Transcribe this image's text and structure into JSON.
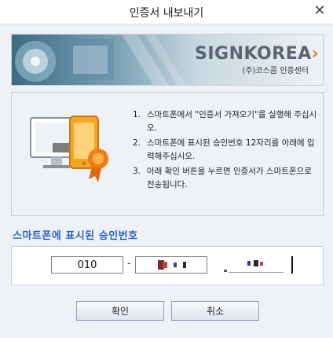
{
  "window": {
    "title": "인증서 내보내기",
    "close_glyph": "✕"
  },
  "banner": {
    "logo_text": "SIGNKOREA",
    "logo_arrow": "›",
    "logo_subtitle": "(주)코스콤 인증센터",
    "accent_color": "#f07b18"
  },
  "instructions": {
    "steps": [
      {
        "num": "1.",
        "text": "스마트폰에서 \"인증서 가져오기\"를 실행해 주십시오."
      },
      {
        "num": "2.",
        "text": "스마트폰에 표시된 승인번호 12자리를 아래에 입력해주십시오."
      },
      {
        "num": "3.",
        "text": "아래 확인 버튼을 누르면 인증서가 스마트폰으로 전송됩니다."
      }
    ]
  },
  "approval": {
    "heading": "스마트폰에 표시된 승인번호",
    "heading_color": "#2a63c4",
    "part1": "010",
    "separator": "-",
    "part2": "",
    "part3": ""
  },
  "buttons": {
    "confirm_label": "확인",
    "cancel_label": "취소"
  }
}
